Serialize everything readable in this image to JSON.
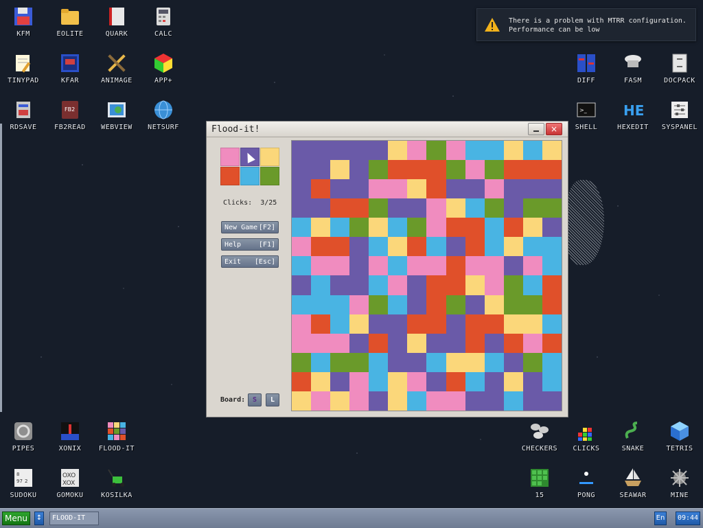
{
  "desktop": {
    "icons_left": [
      {
        "label": "KFM",
        "icon": "floppy-disk-icon"
      },
      {
        "label": "EOLITE",
        "icon": "folder-icon"
      },
      {
        "label": "QUARK",
        "icon": "notebook-icon"
      },
      {
        "label": "CALC",
        "icon": "calculator-icon"
      },
      {
        "label": "TINYPAD",
        "icon": "notepad-icon"
      },
      {
        "label": "KFAR",
        "icon": "file-manager-icon"
      },
      {
        "label": "ANIMAGE",
        "icon": "pencil-ruler-icon"
      },
      {
        "label": "APP+",
        "icon": "rubiks-cube-icon"
      },
      {
        "label": "RDSAVE",
        "icon": "rdsave-icon"
      },
      {
        "label": "FB2READ",
        "icon": "book-icon"
      },
      {
        "label": "WEBVIEW",
        "icon": "webview-icon"
      },
      {
        "label": "NETSURF",
        "icon": "globe-icon"
      },
      {
        "label": "PIPES",
        "icon": "pipes-icon"
      },
      {
        "label": "XONIX",
        "icon": "xonix-icon"
      },
      {
        "label": "FLOOD-IT",
        "icon": "flood-it-icon"
      },
      {
        "label": "SUDOKU",
        "icon": "sudoku-icon"
      },
      {
        "label": "GOMOKU",
        "icon": "gomoku-icon"
      },
      {
        "label": "KOSILKA",
        "icon": "lawnmower-icon"
      }
    ],
    "icons_right": [
      {
        "label": "DIFF",
        "icon": "diff-icon"
      },
      {
        "label": "FASM",
        "icon": "fasm-icon"
      },
      {
        "label": "DOCPACK",
        "icon": "cabinet-icon"
      },
      {
        "label": "SHELL",
        "icon": "terminal-icon"
      },
      {
        "label": "HEXEDIT",
        "icon": "hexedit-icon"
      },
      {
        "label": "SYSPANEL",
        "icon": "sliders-icon"
      },
      {
        "label": "CHECKERS",
        "icon": "checkers-icon"
      },
      {
        "label": "CLICKS",
        "icon": "clicks-icon"
      },
      {
        "label": "SNAKE",
        "icon": "snake-icon"
      },
      {
        "label": "TETRIS",
        "icon": "tetris-icon"
      },
      {
        "label": "15",
        "icon": "fifteen-puzzle-icon"
      },
      {
        "label": "PONG",
        "icon": "pong-icon"
      },
      {
        "label": "SEAWAR",
        "icon": "seawar-icon"
      },
      {
        "label": "MINE",
        "icon": "mine-icon"
      }
    ]
  },
  "notification": {
    "line1": "There is a problem with MTRR configuration.",
    "line2": "Performance can be low",
    "icon": "warning-icon"
  },
  "window": {
    "title": "Flood-it!",
    "clicks_label": "Clicks:",
    "clicks_value": "3/25",
    "buttons": {
      "new_game": "New Game",
      "new_game_key": "[F2]",
      "help": "Help",
      "help_key": "[F1]",
      "exit": "Exit",
      "exit_key": "[Esc]"
    },
    "board_label": "Board:",
    "board_small": "S",
    "board_large": "L",
    "palette": [
      "#f08cbf",
      "#6a5aa8",
      "#fbd77a",
      "#e0502a",
      "#49b4e3",
      "#6a9a2a"
    ],
    "grid_rows": [
      "BBBBBYPGPCCYCYB",
      "BBYBGRRRGPGRRR",
      "BRBBPPYRBBPBBB",
      "BBRRGBBPYCGBGG",
      "CYCGYCGPRRCRYB",
      "PRRBCYRCBRCYCC",
      "CPPBPCPPRPPBPC",
      "BCBBCPBRRYPGCR",
      "CCCPGCBRGBYGGR",
      "PRCYBBRRBRRYYC",
      "PPPBRBYBBRBRPR",
      "GCGGCBBCYYCBGC",
      "RYBPCYPBRCBYBC",
      "YPYPBYCPPBBCBB"
    ],
    "color_map": {
      "B": "#6a5aa8",
      "P": "#f08cbf",
      "Y": "#fbd77a",
      "R": "#e0502a",
      "C": "#49b4e3",
      "G": "#6a9a2a"
    }
  },
  "taskbar": {
    "menu_label": "Menu",
    "arrows": "↕",
    "task_label": "FLOOD-IT",
    "lang": "En",
    "clock": "09:44"
  }
}
